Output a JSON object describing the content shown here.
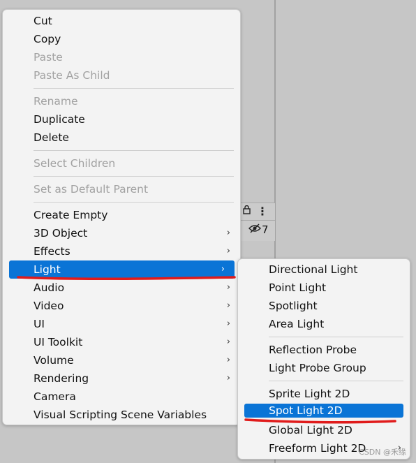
{
  "main_menu": {
    "items": [
      {
        "label": "Cut",
        "enabled": true
      },
      {
        "label": "Copy",
        "enabled": true
      },
      {
        "label": "Paste",
        "enabled": false
      },
      {
        "label": "Paste As Child",
        "enabled": false
      },
      {
        "label": "Rename",
        "enabled": false
      },
      {
        "label": "Duplicate",
        "enabled": true
      },
      {
        "label": "Delete",
        "enabled": true
      },
      {
        "label": "Select Children",
        "enabled": false
      },
      {
        "label": "Set as Default Parent",
        "enabled": false
      },
      {
        "label": "Create Empty",
        "enabled": true
      },
      {
        "label": "3D Object",
        "enabled": true,
        "submenu": true
      },
      {
        "label": "Effects",
        "enabled": true,
        "submenu": true
      },
      {
        "label": "Light",
        "enabled": true,
        "submenu": true,
        "selected": true
      },
      {
        "label": "Audio",
        "enabled": true,
        "submenu": true
      },
      {
        "label": "Video",
        "enabled": true,
        "submenu": true
      },
      {
        "label": "UI",
        "enabled": true,
        "submenu": true
      },
      {
        "label": "UI Toolkit",
        "enabled": true,
        "submenu": true
      },
      {
        "label": "Volume",
        "enabled": true,
        "submenu": true
      },
      {
        "label": "Rendering",
        "enabled": true,
        "submenu": true
      },
      {
        "label": "Camera",
        "enabled": true
      },
      {
        "label": "Visual Scripting Scene Variables",
        "enabled": true
      }
    ]
  },
  "light_submenu": {
    "items": [
      {
        "label": "Directional Light"
      },
      {
        "label": "Point Light"
      },
      {
        "label": "Spotlight"
      },
      {
        "label": "Area Light"
      },
      {
        "label": "Reflection Probe"
      },
      {
        "label": "Light Probe Group"
      },
      {
        "label": "Sprite Light 2D"
      },
      {
        "label": "Spot Light 2D",
        "selected": true
      },
      {
        "label": "Global Light 2D"
      },
      {
        "label": "Freeform Light 2D",
        "submenu": true
      }
    ]
  },
  "inspector": {
    "hidden_count": "7"
  },
  "icons": {
    "submenu_arrow": "›",
    "lock": "lock-icon",
    "more": "more-vert-icon",
    "eye": "eye-slash-icon"
  },
  "colors": {
    "highlight": "#0a74d6",
    "annotation": "#e01b1b",
    "menu_bg": "#f3f3f3"
  },
  "watermark": "CSDN @禾缘"
}
